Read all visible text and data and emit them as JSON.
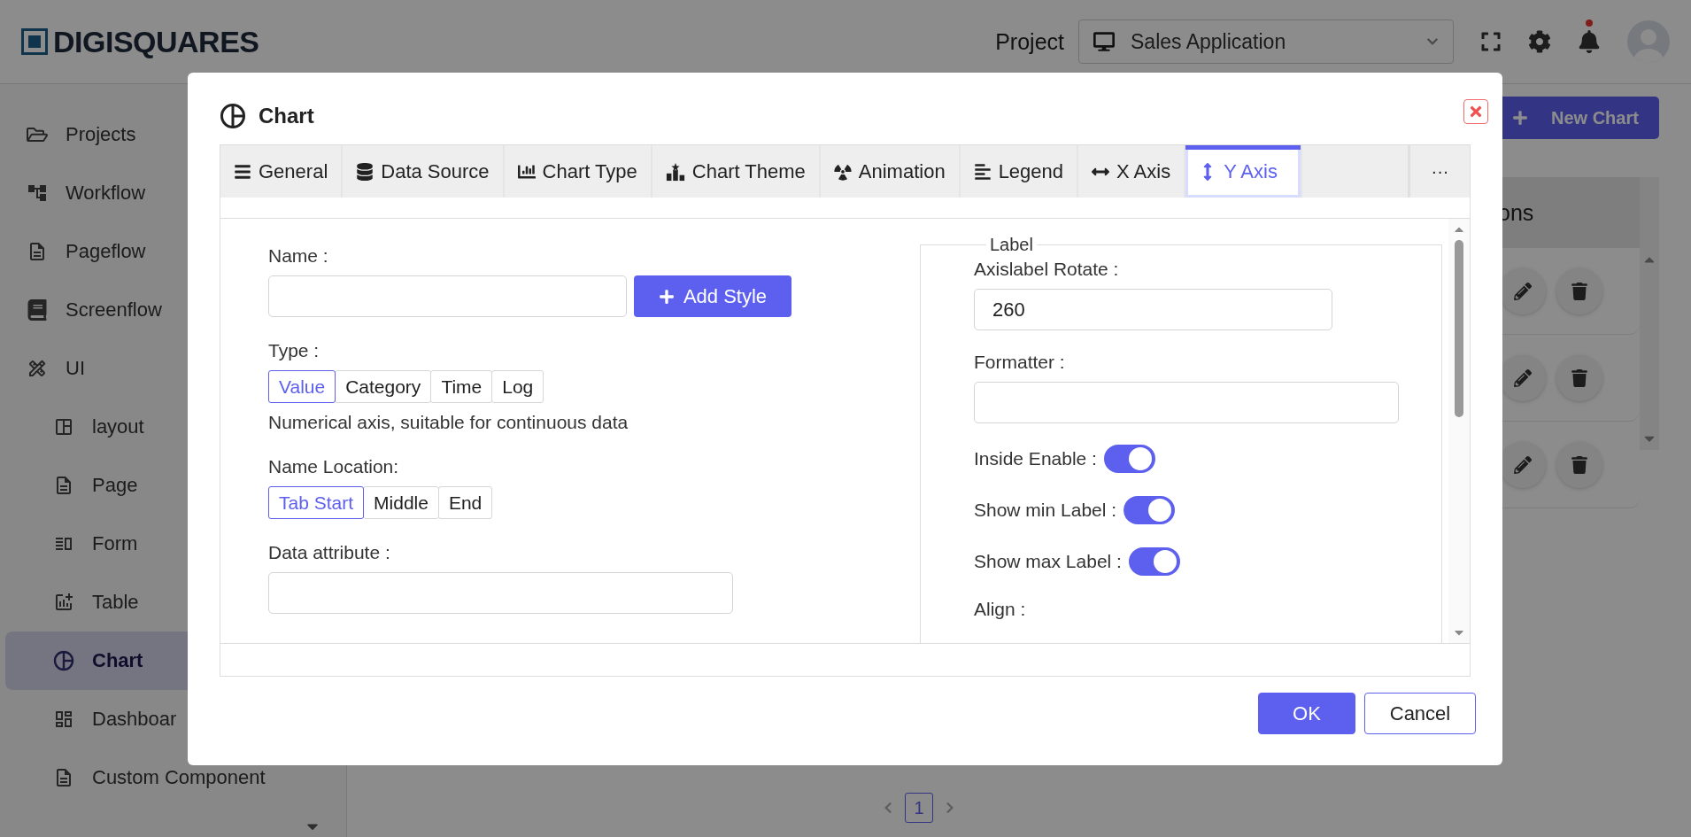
{
  "header": {
    "logo": "DIGISQUARES",
    "project_label": "Project",
    "project_value": "Sales Application",
    "notification": true
  },
  "sidebar": {
    "items": [
      {
        "label": "Projects",
        "selected": false
      },
      {
        "label": "Workflow",
        "selected": false
      },
      {
        "label": "Pageflow",
        "selected": false
      },
      {
        "label": "Screenflow",
        "selected": false
      },
      {
        "label": "UI",
        "selected": false,
        "children": [
          {
            "label": "layout",
            "selected": false
          },
          {
            "label": "Page",
            "selected": false
          },
          {
            "label": "Form",
            "selected": false
          },
          {
            "label": "Table",
            "selected": false
          },
          {
            "label": "Chart",
            "selected": true
          },
          {
            "label": "Dashboar",
            "selected": false
          },
          {
            "label": "Custom Component",
            "selected": false
          }
        ]
      }
    ]
  },
  "main": {
    "new_button": "New Chart",
    "table_header": "ons",
    "rows": [
      {
        "kind": "actions"
      },
      {
        "kind": "actions"
      },
      {
        "kind": "actions"
      }
    ],
    "pages": [
      {
        "label": "1",
        "selected": true
      }
    ]
  },
  "dialog": {
    "title": "Chart",
    "tabs": [
      {
        "label": "General",
        "selected": false
      },
      {
        "label": "Data Source",
        "selected": false
      },
      {
        "label": "Chart Type",
        "selected": false
      },
      {
        "label": "Chart Theme",
        "selected": false
      },
      {
        "label": "Animation",
        "selected": false
      },
      {
        "label": "Legend",
        "selected": false
      },
      {
        "label": "X Axis",
        "selected": false
      },
      {
        "label": "Y Axis",
        "selected": true
      }
    ],
    "more": "···",
    "left": {
      "fields": [
        {
          "kind": "text_button",
          "label": "Name :",
          "button": "Add Style"
        },
        {
          "kind": "segmented",
          "label": "Type :",
          "options": [
            {
              "label": "Value",
              "selected": true
            },
            {
              "label": "Category",
              "selected": false
            },
            {
              "label": "Time",
              "selected": false
            },
            {
              "label": "Log",
              "selected": false
            }
          ],
          "hint": "Numerical axis, suitable for continuous data"
        },
        {
          "kind": "segmented",
          "label": "Name Location:",
          "options": [
            {
              "label": "Tab Start",
              "selected": true
            },
            {
              "label": "Middle",
              "selected": false
            },
            {
              "label": "End",
              "selected": false
            }
          ]
        },
        {
          "kind": "text",
          "label": "Data attribute :"
        }
      ]
    },
    "right": {
      "legend": "Label",
      "fields": [
        {
          "kind": "text",
          "label": "Axislabel Rotate :",
          "value": "260"
        },
        {
          "kind": "text",
          "label": "Formatter :"
        },
        {
          "kind": "switch",
          "label": "Inside Enable :",
          "on": true
        },
        {
          "kind": "switch",
          "label": "Show min Label :",
          "on": true
        },
        {
          "kind": "switch",
          "label": "Show max Label :",
          "on": true
        },
        {
          "kind": "label",
          "label": "Align :"
        }
      ]
    },
    "buttons": [
      {
        "label": "OK",
        "kind": "primary"
      },
      {
        "label": "Cancel",
        "kind": "secondary"
      }
    ]
  }
}
